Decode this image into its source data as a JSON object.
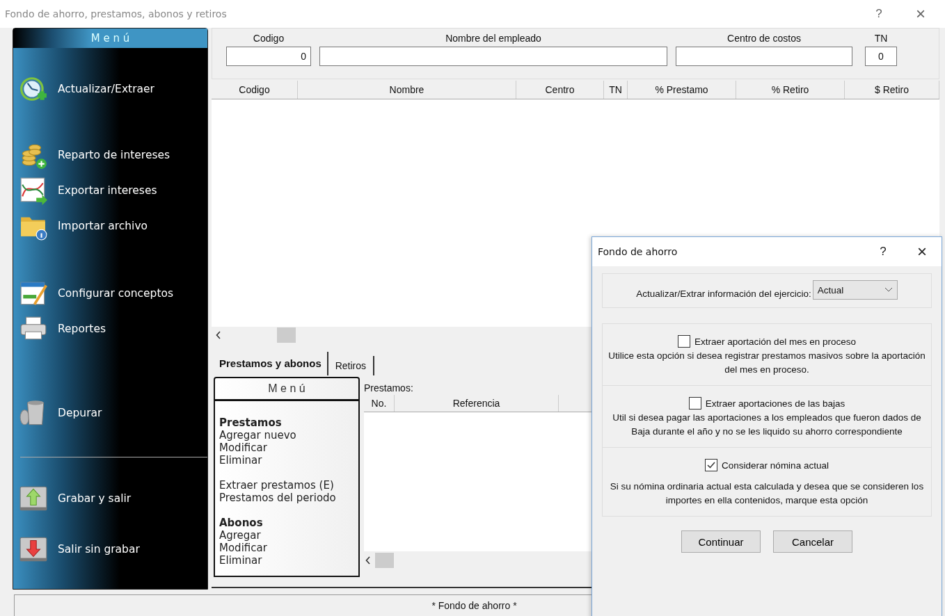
{
  "window": {
    "title": "Fondo de ahorro, prestamos, abonos y retiros",
    "help": "?",
    "close": "×"
  },
  "sidebar": {
    "title": "M e n ú",
    "groups": [
      [
        {
          "label": "Actualizar/Extraer"
        }
      ],
      [
        {
          "label": "Reparto de intereses"
        },
        {
          "label": "Exportar intereses"
        },
        {
          "label": "Importar archivo"
        }
      ],
      [
        {
          "label": "Configurar conceptos"
        },
        {
          "label": "Reportes"
        }
      ],
      [
        {
          "label": "Depurar"
        }
      ],
      [
        {
          "label": "Grabar y salir"
        },
        {
          "label": "Salir sin grabar"
        }
      ]
    ]
  },
  "filters": [
    {
      "label": "Codigo",
      "value": "0"
    },
    {
      "label": "Nombre del empleado"
    },
    {
      "label": "Centro de costos"
    },
    {
      "label": "TN",
      "value": "0"
    }
  ],
  "table": {
    "columns": [
      "Codigo",
      "Nombre",
      "Centro",
      "TN",
      "% Prestamo",
      "% Retiro",
      "$ Retiro"
    ]
  },
  "tabs": [
    {
      "label": "Prestamos y abonos",
      "selected": true
    },
    {
      "label": "Retiros",
      "selected": false
    }
  ],
  "submenu": {
    "title": "M e n ú",
    "sections": [
      {
        "heading": "Prestamos",
        "items": [
          "Agregar nuevo",
          "Modificar",
          "Eliminar"
        ]
      },
      {
        "items": [
          "Extraer prestamos (E)",
          "Prestamos del periodo"
        ]
      },
      {
        "heading": "Abonos",
        "items": [
          "Agregar",
          "Modificar",
          "Eliminar"
        ]
      }
    ]
  },
  "loans": {
    "label": "Prestamos:",
    "columns": [
      "No.",
      "Referencia"
    ]
  },
  "status_bar": "* Fondo de ahorro *",
  "dialog": {
    "title": "Fondo de ahorro",
    "help": "?",
    "close": "×",
    "exercise": {
      "label": "Actualizar/Extrar información del ejercicio:",
      "value": "Actual"
    },
    "options": [
      {
        "label": "Extraer aportación del mes en proceso",
        "checked": false,
        "description": "Utilice esta opción si desea registrar prestamos masivos sobre la aportación del mes en proceso."
      },
      {
        "label": "Extraer aportaciones de las bajas",
        "checked": false,
        "description": "Util si desea pagar las aportaciones a los empleados que fueron dados de Baja durante el año y no se les liquido su ahorro correspondiente"
      },
      {
        "label": "Considerar nómina actual",
        "checked": true,
        "description": "Si su nómina ordinaria actual esta calculada y desea que se consideren los importes en ella contenidos, marque esta opción"
      }
    ],
    "buttons": [
      "Continuar",
      "Cancelar"
    ]
  }
}
